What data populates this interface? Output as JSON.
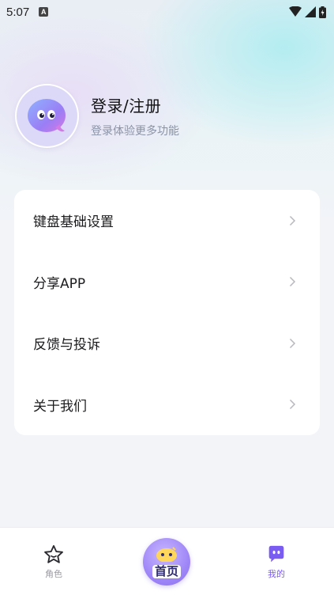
{
  "status_bar": {
    "time": "5:07",
    "notification_badge": "A"
  },
  "profile": {
    "title": "登录/注册",
    "subtitle": "登录体验更多功能"
  },
  "menu": {
    "items": [
      {
        "label": "键盘基础设置"
      },
      {
        "label": "分享APP"
      },
      {
        "label": "反馈与投诉"
      },
      {
        "label": "关于我们"
      }
    ]
  },
  "tab_bar": {
    "role_label": "角色",
    "home_label": "首页",
    "mine_label": "我的"
  },
  "colors": {
    "accent": "#7b5cf2",
    "inactive": "#9a9aa2"
  }
}
